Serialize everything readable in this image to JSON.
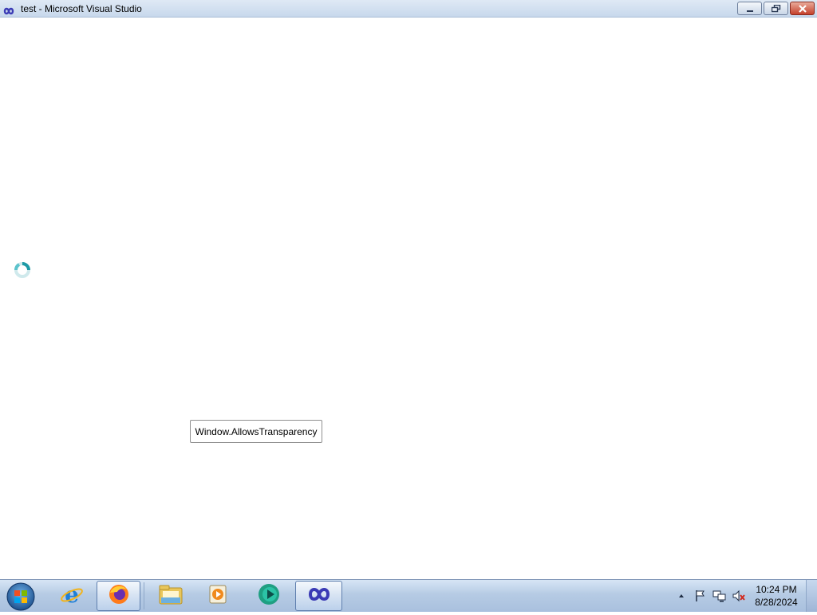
{
  "window": {
    "title": "test - Microsoft Visual Studio",
    "icon": "visual-studio-icon",
    "controls": [
      "minimize-icon",
      "restore-icon",
      "close-icon"
    ]
  },
  "content": {
    "loading_icon": "busy-spinner-icon",
    "button_label": "Window.AllowsTransparency"
  },
  "taskbar": {
    "start_icon": "windows-start-orb-icon",
    "pinned": [
      {
        "icon": "internet-explorer-icon",
        "active": false
      },
      {
        "icon": "firefox-icon",
        "active": true
      },
      {
        "icon": "file-explorer-icon",
        "active": false
      },
      {
        "icon": "media-player-icon",
        "active": false
      },
      {
        "icon": "teal-app-icon",
        "active": false
      },
      {
        "icon": "visual-studio-icon",
        "active": true
      }
    ],
    "tray_icons": [
      "show-hidden-icons-arrow-icon",
      "action-center-flag-icon",
      "network-icon",
      "volume-muted-icon"
    ],
    "clock_time": "10:24 PM",
    "clock_date": "8/28/2024"
  },
  "colors": {
    "taskbar": "#b6cbe4",
    "titlebar": "#dfe9f5",
    "close_button": "#c4402b"
  }
}
